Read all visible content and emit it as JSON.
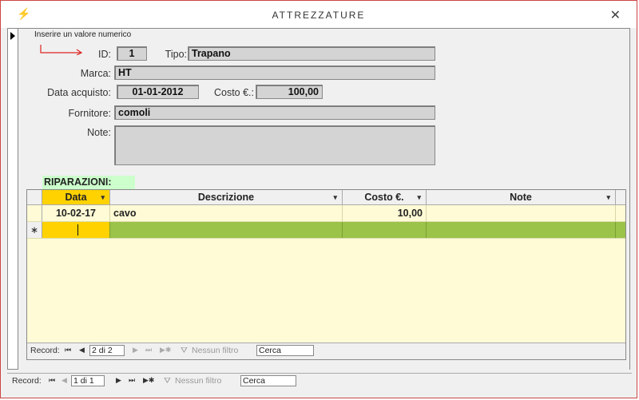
{
  "window": {
    "title": "ATTREZZATURE",
    "close_glyph": "✕",
    "app_icon": "lightning-icon"
  },
  "hint": "Inserire un valore numerico",
  "form": {
    "id_label": "ID:",
    "id_value": "1",
    "tipo_label": "Tipo:",
    "tipo_value": "Trapano",
    "marca_label": "Marca:",
    "marca_value": "HT",
    "data_label": "Data acquisto:",
    "data_value": "01-01-2012",
    "costo_label": "Costo €.:",
    "costo_value": "100,00",
    "fornitore_label": "Fornitore:",
    "fornitore_value": "comoli",
    "note_label": "Note:",
    "note_value": ""
  },
  "riparazioni": {
    "title": "RIPARAZIONI:",
    "columns": [
      "Data",
      "Descrizione",
      "Costo €.",
      "Note"
    ],
    "rows": [
      {
        "data": "10-02-17",
        "descrizione": "cavo",
        "costo": "10,00",
        "note": ""
      }
    ],
    "new_row_marker": "∗",
    "nav": {
      "record_label": "Record:",
      "position": "2 di 2",
      "filter": "Nessun filtro",
      "search": "Cerca"
    }
  },
  "main_nav": {
    "record_label": "Record:",
    "position": "1 di 1",
    "filter": "Nessun filtro",
    "search": "Cerca"
  },
  "colors": {
    "accent": "#ffd200",
    "new_row": "#9bc34a",
    "subform_bg": "#fffbd6",
    "label_bg": "#ccffcc",
    "frame": "#cc4444"
  }
}
